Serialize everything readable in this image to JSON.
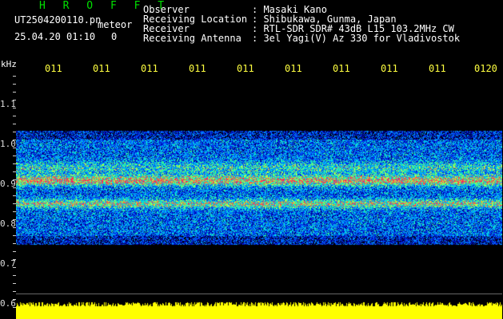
{
  "header": {
    "title": "H R O F F T",
    "filename": "UT2504200110.pn",
    "meteor_label": "meteor",
    "datetime": "25.04.20 01:10",
    "meteor_count": "0"
  },
  "meta": [
    {
      "key": "Observer",
      "value": ": Masaki Kano"
    },
    {
      "key": "Receiving Location",
      "value": ": Shibukawa, Gunma, Japan"
    },
    {
      "key": "Receiver",
      "value": ": RTL-SDR SDR# 43dB L15 103.2MHz CW"
    },
    {
      "key": "Receiving Antenna",
      "value": ": 3el Yagi(V) Az 330 for Vladivostok"
    }
  ],
  "axis": {
    "unit": "kHz",
    "y_ticks": [
      "1.1",
      "1.0",
      "0.9",
      "0.8",
      "0.7",
      "0.6"
    ],
    "x_ticks": [
      "011",
      "011",
      "011",
      "011",
      "011",
      "011",
      "011",
      "011",
      "011",
      "0120"
    ]
  },
  "colors": {
    "background": "#000000",
    "title": "#00e000",
    "time_labels": "#ffff40",
    "signal_bar": "#ffff00"
  }
}
